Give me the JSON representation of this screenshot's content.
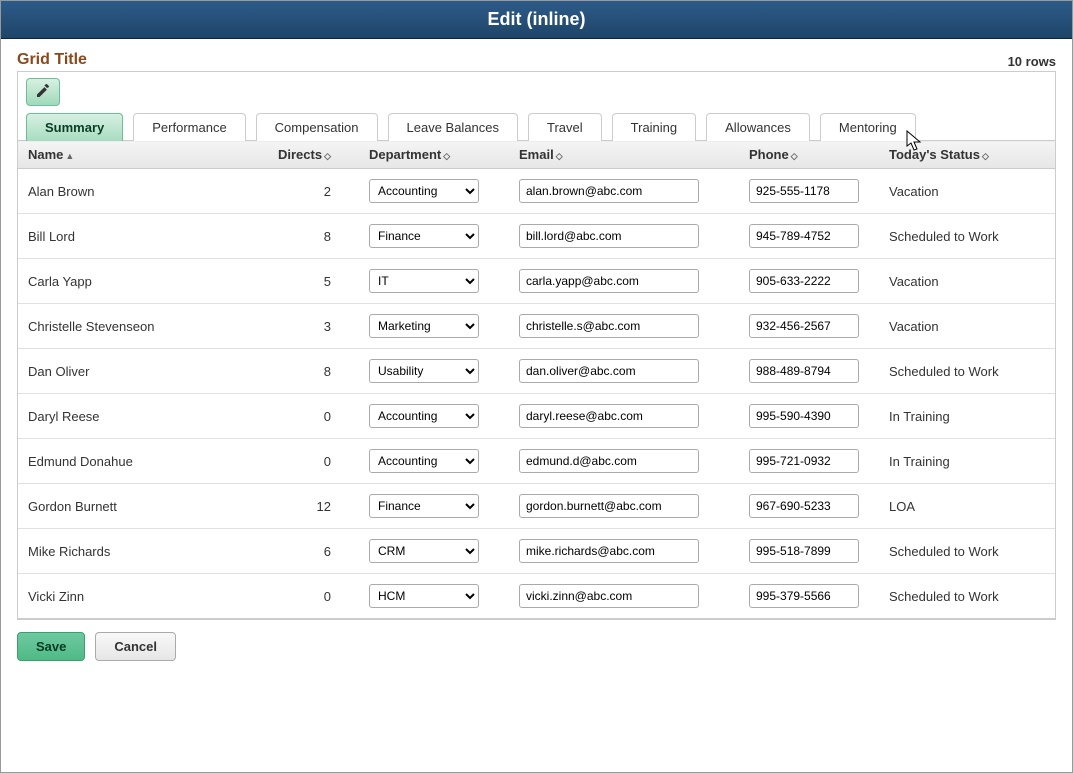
{
  "window": {
    "title": "Edit (inline)"
  },
  "grid": {
    "title": "Grid Title",
    "row_count_label": "10 rows",
    "tabs": [
      {
        "label": "Summary",
        "active": true
      },
      {
        "label": "Performance",
        "active": false
      },
      {
        "label": "Compensation",
        "active": false
      },
      {
        "label": "Leave Balances",
        "active": false
      },
      {
        "label": "Travel",
        "active": false
      },
      {
        "label": "Training",
        "active": false
      },
      {
        "label": "Allowances",
        "active": false
      },
      {
        "label": "Mentoring",
        "active": false
      }
    ],
    "columns": {
      "name": "Name",
      "directs": "Directs",
      "department": "Department",
      "email": "Email",
      "phone": "Phone",
      "status": "Today's Status"
    },
    "department_options": [
      "Accounting",
      "Finance",
      "IT",
      "Marketing",
      "Usability",
      "CRM",
      "HCM"
    ],
    "rows": [
      {
        "name": "Alan Brown",
        "directs": "2",
        "department": "Accounting",
        "email": "alan.brown@abc.com",
        "phone": "925-555-1178",
        "status": "Vacation"
      },
      {
        "name": "Bill Lord",
        "directs": "8",
        "department": "Finance",
        "email": "bill.lord@abc.com",
        "phone": "945-789-4752",
        "status": "Scheduled to Work"
      },
      {
        "name": "Carla Yapp",
        "directs": "5",
        "department": "IT",
        "email": "carla.yapp@abc.com",
        "phone": "905-633-2222",
        "status": "Vacation"
      },
      {
        "name": "Christelle Stevenseon",
        "directs": "3",
        "department": "Marketing",
        "email": "christelle.s@abc.com",
        "phone": "932-456-2567",
        "status": "Vacation"
      },
      {
        "name": "Dan Oliver",
        "directs": "8",
        "department": "Usability",
        "email": "dan.oliver@abc.com",
        "phone": "988-489-8794",
        "status": "Scheduled to Work"
      },
      {
        "name": "Daryl Reese",
        "directs": "0",
        "department": "Accounting",
        "email": "daryl.reese@abc.com",
        "phone": "995-590-4390",
        "status": "In Training"
      },
      {
        "name": "Edmund Donahue",
        "directs": "0",
        "department": "Accounting",
        "email": "edmund.d@abc.com",
        "phone": "995-721-0932",
        "status": "In Training"
      },
      {
        "name": "Gordon Burnett",
        "directs": "12",
        "department": "Finance",
        "email": "gordon.burnett@abc.com",
        "phone": "967-690-5233",
        "status": "LOA"
      },
      {
        "name": "Mike Richards",
        "directs": "6",
        "department": "CRM",
        "email": "mike.richards@abc.com",
        "phone": "995-518-7899",
        "status": "Scheduled to Work"
      },
      {
        "name": "Vicki Zinn",
        "directs": "0",
        "department": "HCM",
        "email": "vicki.zinn@abc.com",
        "phone": "995-379-5566",
        "status": "Scheduled to Work"
      }
    ]
  },
  "buttons": {
    "save": "Save",
    "cancel": "Cancel"
  },
  "icons": {
    "edit": "pencil-icon",
    "sort_asc": "▲",
    "sort_both": "◇"
  }
}
